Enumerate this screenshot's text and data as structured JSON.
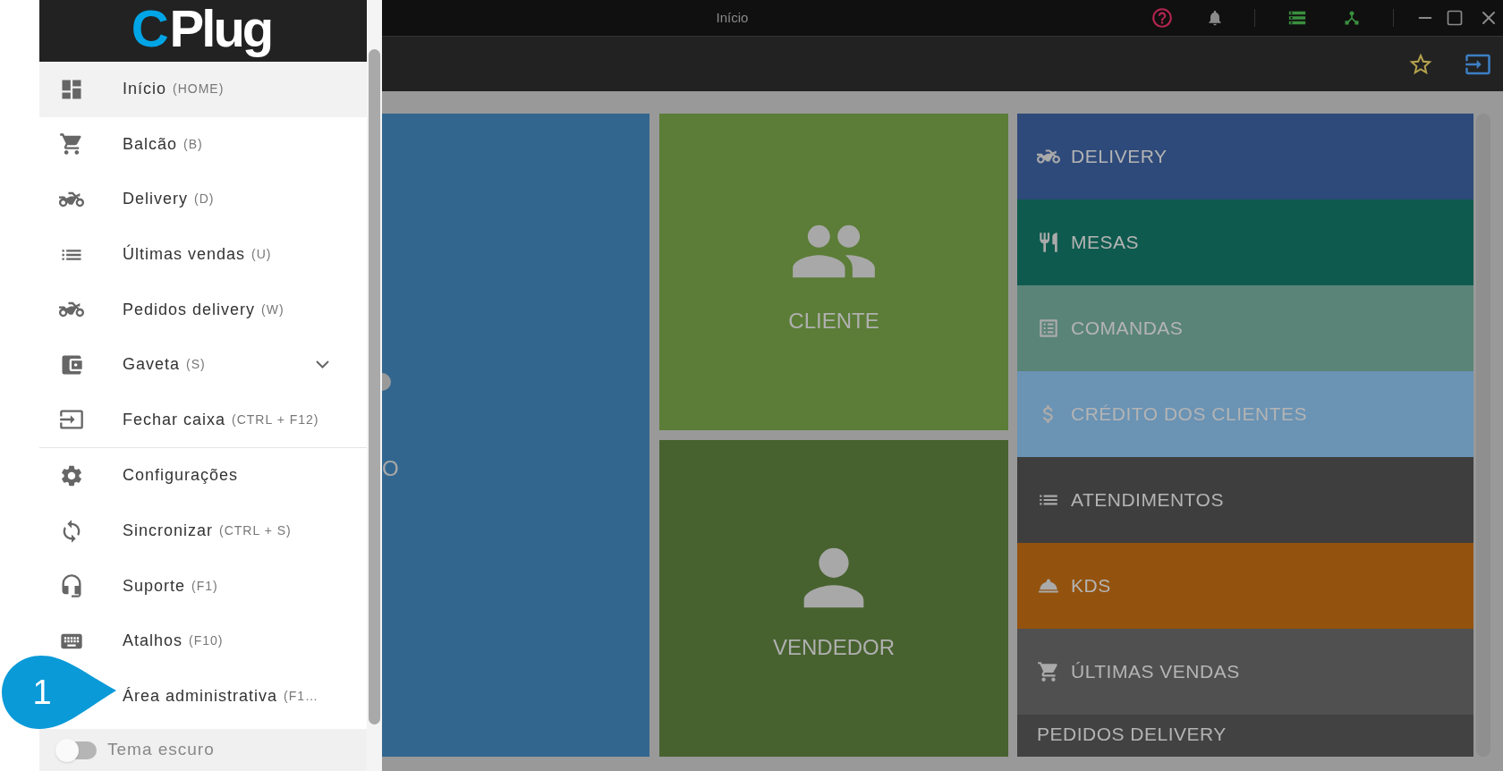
{
  "logo": {
    "mark": "C",
    "text": "Plug"
  },
  "window": {
    "title": "Início"
  },
  "drawer": {
    "items": [
      {
        "kind": "home",
        "label": "Início",
        "shortcut": "(HOME)",
        "selected": true,
        "expandable": false
      },
      {
        "kind": "cart",
        "label": "Balcão",
        "shortcut": "(B)",
        "selected": false,
        "expandable": false
      },
      {
        "kind": "bike",
        "label": "Delivery",
        "shortcut": "(D)",
        "selected": false,
        "expandable": false
      },
      {
        "kind": "list",
        "label": "Últimas vendas",
        "shortcut": "(U)",
        "selected": false,
        "expandable": false
      },
      {
        "kind": "bike",
        "label": "Pedidos delivery",
        "shortcut": "(W)",
        "selected": false,
        "expandable": false
      },
      {
        "kind": "wallet",
        "label": "Gaveta",
        "shortcut": "(S)",
        "selected": false,
        "expandable": true
      },
      {
        "kind": "close",
        "label": "Fechar caixa",
        "shortcut": "(CTRL + F12)",
        "selected": false,
        "expandable": false
      }
    ],
    "items_2": [
      {
        "kind": "settings",
        "label": "Configurações",
        "selected": false
      },
      {
        "kind": "sync",
        "label": "Sincronizar",
        "shortcut": "(CTRL + S)",
        "selected": false
      },
      {
        "kind": "support",
        "label": "Suporte",
        "shortcut": "(F1)",
        "selected": false
      },
      {
        "kind": "keyboard",
        "label": "Atalhos",
        "shortcut": "(F10)",
        "selected": false
      },
      {
        "kind": "admin",
        "label": "Área administrativa",
        "shortcut": "(F1…",
        "selected": false
      }
    ],
    "dark_theme": {
      "label": "Tema escuro",
      "on": false
    }
  },
  "callout": {
    "number": "1"
  },
  "tiles": {
    "left": {
      "label": "O",
      "color": "#33668f"
    },
    "middle": [
      {
        "kind": "people",
        "label": "CLIENTE",
        "color": "#5b7d37"
      },
      {
        "kind": "person",
        "label": "VENDEDOR",
        "color": "#47622f"
      }
    ],
    "list": [
      {
        "kind": "bike",
        "label": "DELIVERY",
        "color": "#2e4a7a"
      },
      {
        "kind": "restaurant",
        "label": "MESAS",
        "color": "#0f5a4e"
      },
      {
        "kind": "listalt",
        "label": "COMANDAS",
        "color": "#5a8478"
      },
      {
        "kind": "money",
        "label": "CRÉDITO DOS CLIENTES",
        "color": "#6a93b4"
      },
      {
        "kind": "list",
        "label": "ATENDIMENTOS",
        "color": "#3e3e3e"
      },
      {
        "kind": "service",
        "label": "KDS",
        "color": "#93530f"
      },
      {
        "kind": "cart",
        "label": "ÚLTIMAS VENDAS",
        "color": "#505050"
      },
      {
        "kind": "none",
        "label": "PEDIDOS DELIVERY",
        "color": "#424242"
      }
    ]
  }
}
